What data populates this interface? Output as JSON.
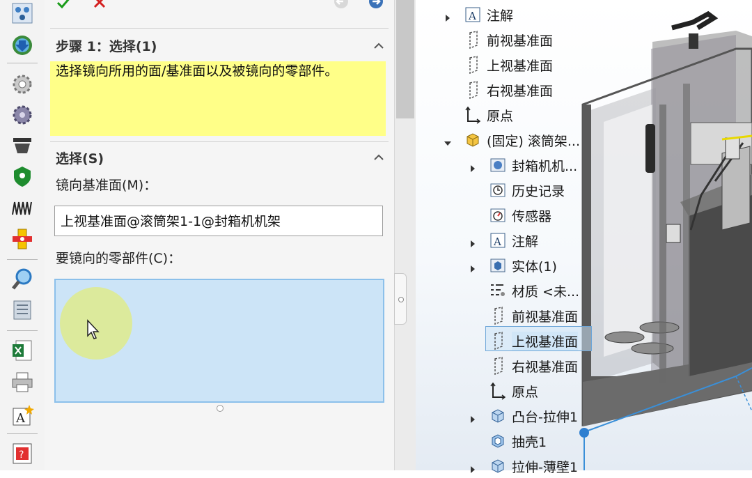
{
  "pm": {
    "ok_icon": "check-icon",
    "cancel_icon": "x-icon",
    "step_header": "步骤 1：选择(1)",
    "message": "选择镜向所用的面/基准面以及被镜向的零部件。",
    "selections_header": "选择(S)",
    "mirror_plane_label": "镜向基准面(M)：",
    "mirror_plane_value": "上视基准面@滚筒架1-1@封箱机机架",
    "components_label": "要镜向的零部件(C)："
  },
  "tree": [
    {
      "label": "注解",
      "icon": "annotation-icon",
      "arrow": "collapsed",
      "indent": 0
    },
    {
      "label": "前视基准面",
      "icon": "plane-icon",
      "arrow": "none",
      "indent": 0
    },
    {
      "label": "上视基准面",
      "icon": "plane-icon",
      "arrow": "none",
      "indent": 0
    },
    {
      "label": "右视基准面",
      "icon": "plane-icon",
      "arrow": "none",
      "indent": 0
    },
    {
      "label": "原点",
      "icon": "origin-icon",
      "arrow": "none",
      "indent": 0
    },
    {
      "label": "(固定) 滚筒架...",
      "icon": "part-icon",
      "arrow": "expanded",
      "indent": 0
    },
    {
      "label": "封箱机机...",
      "icon": "history-folder-icon",
      "arrow": "collapsed",
      "indent": 1
    },
    {
      "label": "历史记录",
      "icon": "history-icon",
      "arrow": "none",
      "indent": 1
    },
    {
      "label": "传感器",
      "icon": "sensor-icon",
      "arrow": "none",
      "indent": 1
    },
    {
      "label": "注解",
      "icon": "annotation-icon",
      "arrow": "collapsed",
      "indent": 1
    },
    {
      "label": "实体(1)",
      "icon": "solid-body-icon",
      "arrow": "collapsed",
      "indent": 1
    },
    {
      "label": "材质 <未...",
      "icon": "material-icon",
      "arrow": "none",
      "indent": 1
    },
    {
      "label": "前视基准面",
      "icon": "plane-icon",
      "arrow": "none",
      "indent": 1
    },
    {
      "label": "上视基准面",
      "icon": "plane-icon",
      "arrow": "none",
      "indent": 1,
      "selected": true
    },
    {
      "label": "右视基准面",
      "icon": "plane-icon",
      "arrow": "none",
      "indent": 1
    },
    {
      "label": "原点",
      "icon": "origin-icon",
      "arrow": "none",
      "indent": 1
    },
    {
      "label": "凸台-拉伸1",
      "icon": "extrude-icon",
      "arrow": "collapsed",
      "indent": 1
    },
    {
      "label": "抽壳1",
      "icon": "shell-icon",
      "arrow": "none",
      "indent": 1
    },
    {
      "label": "拉伸-薄壁1",
      "icon": "extrude-icon",
      "arrow": "collapsed",
      "indent": 1
    }
  ],
  "toolbar_icons": [
    "assembly-tree-icon",
    "update-icon",
    "gear-icon",
    "gear-settings-icon",
    "belt-icon",
    "shield-icon",
    "spring-icon",
    "mate-icon",
    "search-icon",
    "reference-icon",
    "excel-icon",
    "print-icon",
    "text-icon",
    "help-icon"
  ],
  "colors": {
    "message_bg": "#ffff88",
    "selection_list_bg": "#cce4f7",
    "ok_green": "#1a9c1a",
    "cancel_red": "#d42020"
  }
}
